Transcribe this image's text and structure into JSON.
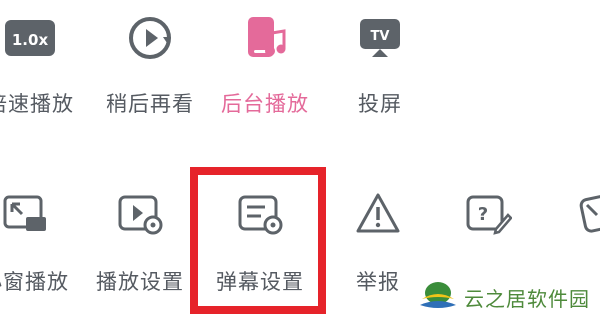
{
  "row1": [
    {
      "label": "倍速播放",
      "icon": "speed-1x-icon",
      "icon_text": "1.0x"
    },
    {
      "label": "稍后再看",
      "icon": "watch-later-icon"
    },
    {
      "label": "后台播放",
      "icon": "background-play-icon",
      "active": true
    },
    {
      "label": "投屏",
      "icon": "cast-tv-icon",
      "icon_text": "TV"
    }
  ],
  "row2": [
    {
      "label": "小窗播放",
      "icon": "picture-in-picture-icon"
    },
    {
      "label": "播放设置",
      "icon": "play-settings-icon"
    },
    {
      "label": "弹幕设置",
      "icon": "danmaku-settings-icon",
      "highlighted": true
    },
    {
      "label": "举报",
      "icon": "report-warning-icon"
    },
    {
      "label": "",
      "icon": "feedback-edit-icon",
      "icon_text": "?"
    },
    {
      "label": "",
      "icon": "more-cut-icon"
    }
  ],
  "colors": {
    "text": "#555a61",
    "active": "#e46a9a",
    "icon_dark": "#5d6369",
    "highlight_border": "#e6232a"
  },
  "watermark": {
    "text": "云之居软件园"
  }
}
